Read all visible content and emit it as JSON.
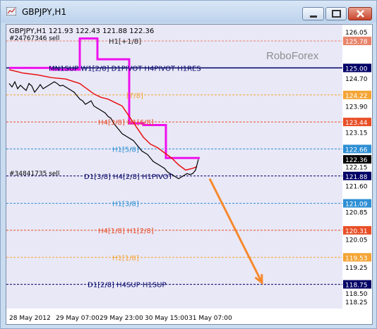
{
  "window": {
    "title": "GBPJPY,H1",
    "buttons": {
      "minimize": "minimize",
      "maximize": "maximize",
      "close": "close"
    }
  },
  "chart_data": {
    "type": "line",
    "symbol_header": "GBPJPY,H1  121.93 122.43 121.88 122.36",
    "watermark": "RoboForex",
    "x_tick_labels": [
      "28 May 2012",
      "29 May 07:00",
      "29 May 23:00",
      "30 May 15:00",
      "31 May 07:00"
    ],
    "y_tick_labels": [
      "126.05",
      "125.78",
      "125.00",
      "124.22",
      "123.44",
      "122.66",
      "122.36",
      "122.15",
      "121.88",
      "121.09",
      "120.31",
      "119.53",
      "118.75",
      "118.25"
    ],
    "y_axis_plain_ticks": [
      126.05,
      124.7,
      123.9,
      123.15,
      122.15,
      121.6,
      120.85,
      120.05,
      119.25,
      118.5,
      118.25
    ],
    "ylim": [
      118.05,
      126.25
    ],
    "level_lines": [
      {
        "price": 125.78,
        "label": "H1[+1/8]",
        "axis_label": "125.78",
        "color": "#e8836a",
        "style": "dashed",
        "text_color": "#222222"
      },
      {
        "price": 125.0,
        "label": "MN1SUP W1[2/8] D1PIVOT H4PIVOT H1RES",
        "axis_label": "125.00",
        "color": "#000066",
        "style": "solid",
        "text_color": "#000066"
      },
      {
        "price": 124.22,
        "label": "[7/8]",
        "axis_label": "124.22",
        "color": "#f4a536",
        "style": "dashed",
        "text_color": "#f4a536"
      },
      {
        "price": 123.44,
        "label": "H4[3/8] H1[6/8]",
        "axis_label": "123.44",
        "color": "#e84f27",
        "style": "dashed",
        "text_color": "#e84f27"
      },
      {
        "price": 122.66,
        "label": "H1[5/8]",
        "axis_label": "122.66",
        "color": "#2e8fd4",
        "style": "dashed",
        "text_color": "#2e8fd4"
      },
      {
        "price": 121.88,
        "label": "D1[3/8] H4[2/8] H1PIVOT",
        "axis_label": "121.88",
        "color": "#000066",
        "style": "dashed",
        "text_color": "#000066"
      },
      {
        "price": 121.09,
        "label": "H1[3/8]",
        "axis_label": "121.09",
        "color": "#2e8fd4",
        "style": "dashed",
        "text_color": "#2e8fd4"
      },
      {
        "price": 120.31,
        "label": "H4[1/8] H1[2/8]",
        "axis_label": "120.31",
        "color": "#e84f27",
        "style": "dashed",
        "text_color": "#e84f27"
      },
      {
        "price": 119.53,
        "label": "H1[1/8]",
        "axis_label": "119.53",
        "color": "#f4a536",
        "style": "dashed",
        "text_color": "#f4a536"
      },
      {
        "price": 118.75,
        "label": "D1[2/8] H4SUP H1SUP",
        "axis_label": "118.75",
        "color": "#000066",
        "style": "dashed",
        "text_color": "#000066"
      }
    ],
    "current_price": {
      "price": 122.36,
      "label": "122.36"
    },
    "order_lines": [
      {
        "price": 125.78,
        "label": "#24767346 sell"
      },
      {
        "price": 121.88,
        "label": "#34841735 sell"
      }
    ],
    "price_series": {
      "name": "",
      "color": "#000000",
      "x": [
        0,
        4,
        8,
        12,
        16,
        20,
        24,
        28,
        32,
        36,
        40,
        44,
        48,
        52,
        56,
        60,
        64,
        68,
        72,
        76,
        80,
        84,
        88,
        92,
        96,
        100,
        104,
        108,
        112,
        116,
        120,
        124,
        128,
        132,
        136,
        140,
        144,
        148,
        152,
        156,
        160,
        164,
        168,
        172,
        176,
        180,
        184,
        188,
        192,
        196,
        200,
        204,
        208,
        212,
        216,
        220,
        224,
        228,
        232,
        236,
        240,
        244,
        248,
        252,
        256,
        260,
        264,
        268
      ],
      "values": [
        124.55,
        124.45,
        124.6,
        124.4,
        124.5,
        124.42,
        124.35,
        124.55,
        124.48,
        124.3,
        124.4,
        124.52,
        124.4,
        124.45,
        124.5,
        124.55,
        124.6,
        124.55,
        124.48,
        124.5,
        124.45,
        124.4,
        124.35,
        124.3,
        124.2,
        124.1,
        124.05,
        123.95,
        124.0,
        124.05,
        123.9,
        123.85,
        123.8,
        123.75,
        123.7,
        123.6,
        123.55,
        123.4,
        123.3,
        123.2,
        123.1,
        123.05,
        123.0,
        122.95,
        122.9,
        122.8,
        122.7,
        122.6,
        122.55,
        122.5,
        122.4,
        122.3,
        122.25,
        122.2,
        122.15,
        122.1,
        122.0,
        121.95,
        121.9,
        121.85,
        121.8,
        121.85,
        121.9,
        121.95,
        121.92,
        121.95,
        122.05,
        122.36
      ]
    },
    "ma_red": {
      "name": "",
      "color": "#e81010",
      "x": [
        0,
        20,
        40,
        60,
        80,
        100,
        110,
        120,
        130,
        140,
        150,
        160,
        170,
        180,
        190,
        200,
        210,
        220,
        230,
        240,
        250,
        260,
        266
      ],
      "values": [
        124.95,
        124.85,
        124.8,
        124.72,
        124.68,
        124.55,
        124.4,
        124.25,
        124.15,
        124.1,
        124.0,
        123.9,
        123.6,
        123.3,
        123.0,
        122.8,
        122.7,
        122.55,
        122.4,
        122.2,
        122.05,
        122.1,
        122.15
      ]
    },
    "ma_magenta": {
      "name": "",
      "color": "#ee10ee",
      "x": [
        0,
        60,
        60,
        100,
        100,
        125,
        125,
        170,
        170,
        190,
        190,
        222,
        222,
        270
      ],
      "values": [
        125.0,
        125.0,
        124.95,
        124.95,
        125.85,
        125.85,
        125.25,
        125.25,
        123.4,
        123.4,
        123.35,
        123.35,
        122.4,
        122.4
      ]
    },
    "projection_arrow": {
      "from_price": 121.8,
      "to_price": 118.8,
      "color": "#f7892d"
    }
  }
}
